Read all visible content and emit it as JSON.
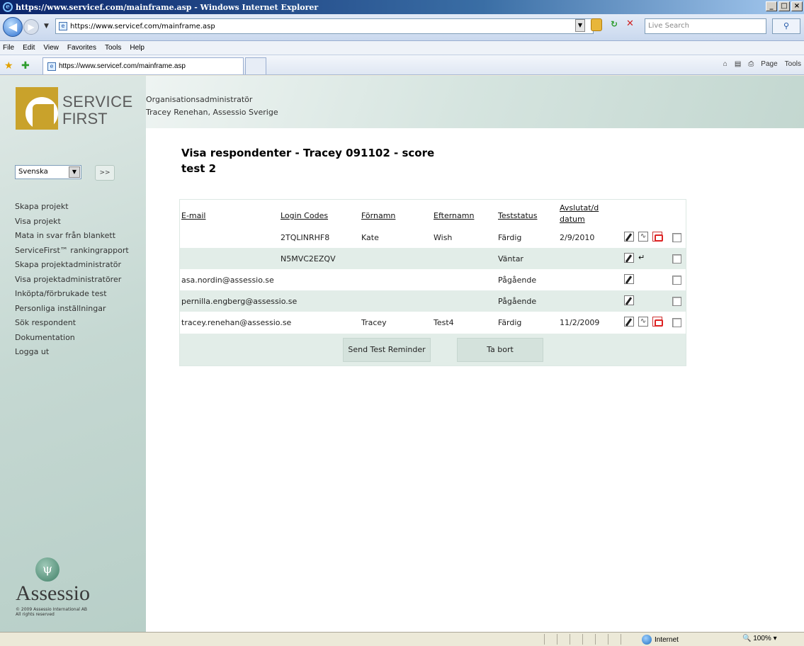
{
  "window": {
    "title": "https://www.servicef.com/mainframe.asp - Windows Internet Explorer",
    "controls": [
      "_",
      "□",
      "×"
    ]
  },
  "addressbar": {
    "url": "https://www.servicef.com/mainframe.asp",
    "search_placeholder": "Live Search"
  },
  "menubar": [
    "File",
    "Edit",
    "View",
    "Favorites",
    "Tools",
    "Help"
  ],
  "favbar": {
    "tab_title": "https://www.servicef.com/mainframe.asp",
    "commands": [
      "Page",
      "Tools"
    ]
  },
  "logo": {
    "line1": "SERVICE",
    "line2": "FIRST"
  },
  "header": {
    "role": "Organisationsadministratör",
    "user": "Tracey Renehan, Assessio Sverige"
  },
  "language": {
    "selected": "Svenska",
    "go_label": ">>"
  },
  "nav": [
    "Skapa projekt",
    "Visa projekt",
    "Mata in svar från blankett",
    "ServiceFirst™ rankingrapport",
    "Skapa projektadministratör",
    "Visa projektadministratörer",
    "Inköpta/förbrukade test",
    "Personliga inställningar",
    "Sök respondent",
    "Dokumentation",
    "Logga ut"
  ],
  "footer_logo": {
    "name": "Assessio",
    "copyright": "© 2009 Assessio International AB",
    "rights": "All rights reserved"
  },
  "page": {
    "title_line1": "Visa respondenter - Tracey 091102 - score",
    "title_line2": "test 2"
  },
  "table": {
    "headers": {
      "email": "E-mail",
      "login": "Login Codes",
      "first": "Förnamn",
      "last": "Efternamn",
      "status": "Teststatus",
      "done1": "Avslutat/d",
      "done2": "datum"
    },
    "rows": [
      {
        "email": "",
        "login": "2TQLINRHF8",
        "first": "Kate",
        "last": "Wish",
        "status": "Färdig",
        "date": "2/9/2010"
      },
      {
        "email": "",
        "login": "N5MVC2EZQV",
        "first": "",
        "last": "",
        "status": "Väntar",
        "date": ""
      },
      {
        "email": "asa.nordin@assessio.se",
        "login": "",
        "first": "",
        "last": "",
        "status": "Pågående",
        "date": ""
      },
      {
        "email": "pernilla.engberg@assessio.se",
        "login": "",
        "first": "",
        "last": "",
        "status": "Pågående",
        "date": ""
      },
      {
        "email": "tracey.renehan@assessio.se",
        "login": "",
        "first": "Tracey",
        "last": "Test4",
        "status": "Färdig",
        "date": "11/2/2009"
      }
    ]
  },
  "buttons": {
    "reminder": "Send Test Reminder",
    "delete": "Ta bort"
  },
  "statusbar": {
    "zone": "Internet",
    "zoom": "100%"
  }
}
